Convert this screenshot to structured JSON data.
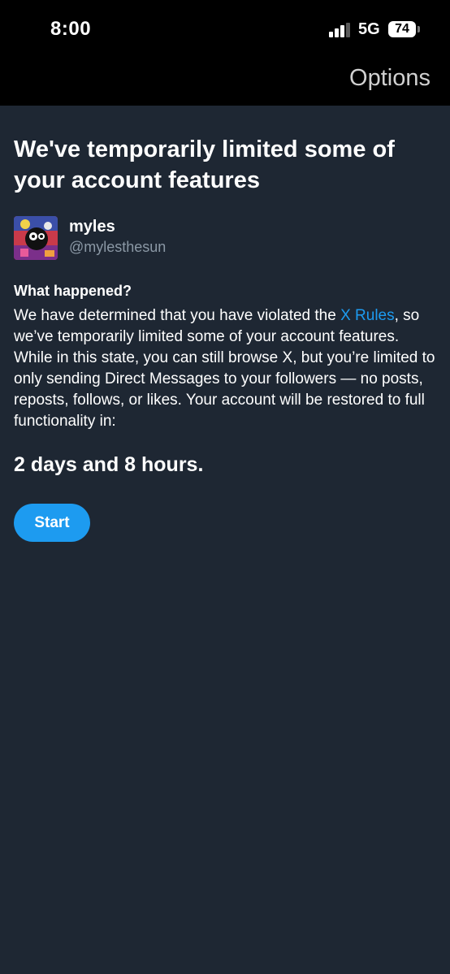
{
  "status_bar": {
    "time": "8:00",
    "network": "5G",
    "battery": "74",
    "icons": [
      "signal-icon",
      "battery-icon"
    ]
  },
  "nav": {
    "options_label": "Options"
  },
  "notice": {
    "title": "We've temporarily limited some of your account features",
    "user": {
      "name": "myles",
      "handle": "@mylesthesun"
    },
    "section_heading": "What happened?",
    "body_before_link": "We have determined that you have violated the ",
    "link_text": "X Rules",
    "body_after_link": ", so we’ve temporarily limited some of your account features. While in this state, you can still browse X, but you’re limited to only sending Direct Messages to your followers — no posts, reposts, follows, or likes. Your account will be restored to full functionality in:",
    "duration": "2 days and 8 hours.",
    "start_label": "Start"
  },
  "colors": {
    "background": "#1e2733",
    "header_background": "#000000",
    "accent": "#1d9bf0",
    "secondary_text": "#8b98a5"
  }
}
